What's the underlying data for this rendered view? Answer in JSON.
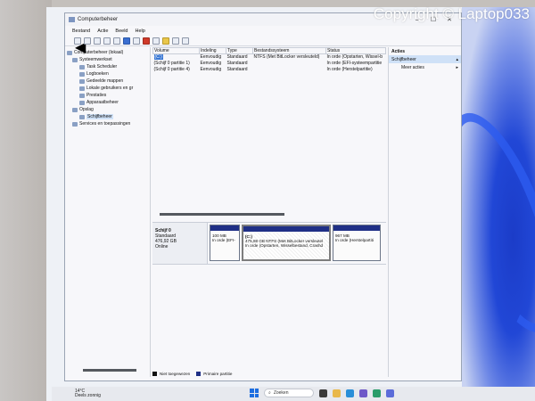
{
  "watermark": "Copyright © Laptop033",
  "window": {
    "title": "Computerbeheer",
    "menu": [
      "Bestand",
      "Actie",
      "Beeld",
      "Help"
    ]
  },
  "tree": [
    {
      "label": "Computerbeheer (lokaal)",
      "indent": 0
    },
    {
      "label": "Systeemwerkset",
      "indent": 1
    },
    {
      "label": "Task Scheduler",
      "indent": 2
    },
    {
      "label": "Logboeken",
      "indent": 2
    },
    {
      "label": "Gedeelde mappen",
      "indent": 2
    },
    {
      "label": "Lokale gebruikers en gr",
      "indent": 2
    },
    {
      "label": "Prestaties",
      "indent": 2
    },
    {
      "label": "Apparaatbeheer",
      "indent": 2
    },
    {
      "label": "Opslag",
      "indent": 1
    },
    {
      "label": "Schijfbeheer",
      "indent": 2,
      "selected": true
    },
    {
      "label": "Services en toepassingen",
      "indent": 1
    }
  ],
  "volumes": {
    "headers": [
      "Volume",
      "Indeling",
      "Type",
      "Bestandssysteem",
      "Status"
    ],
    "rows": [
      [
        "(C:)",
        "Eenvoudig",
        "Standaard",
        "NTFS (Met BitLocker versleuteld)",
        "In orde (Opstarten, Wissel-b"
      ],
      [
        "(Schijf 0 partitie 1)",
        "Eenvoudig",
        "Standaard",
        "",
        "In orde (EFI-systeempartitie"
      ],
      [
        "(Schijf 0 partitie 4)",
        "Eenvoudig",
        "Standaard",
        "",
        "In orde (Herstelpartitie)"
      ]
    ]
  },
  "disk": {
    "name": "Schijf 0",
    "type": "Standaard",
    "size": "476,92 GB",
    "status": "Online",
    "partitions": [
      {
        "line1": "100 MB",
        "line2": "In orde (EFI-"
      },
      {
        "line1": "(C:)",
        "line2": "475,88 GB NTFS (Met BitLocker versleutel",
        "line3": "In orde (Opstarten, Wisselbestand, Crashd"
      },
      {
        "line1": "967 MB",
        "line2": "In orde (Herstelpartiti"
      }
    ]
  },
  "legend": [
    {
      "label": "Niet toegewezen",
      "color": "#111111"
    },
    {
      "label": "Primaire partitie",
      "color": "#1f2f86"
    }
  ],
  "actions": {
    "header": "Acties",
    "section": "Schijfbeheer",
    "item": "Meer acties"
  },
  "taskbar": {
    "temperature": "14°C",
    "weather": "Deels zonnig",
    "search": "Zoeken"
  }
}
